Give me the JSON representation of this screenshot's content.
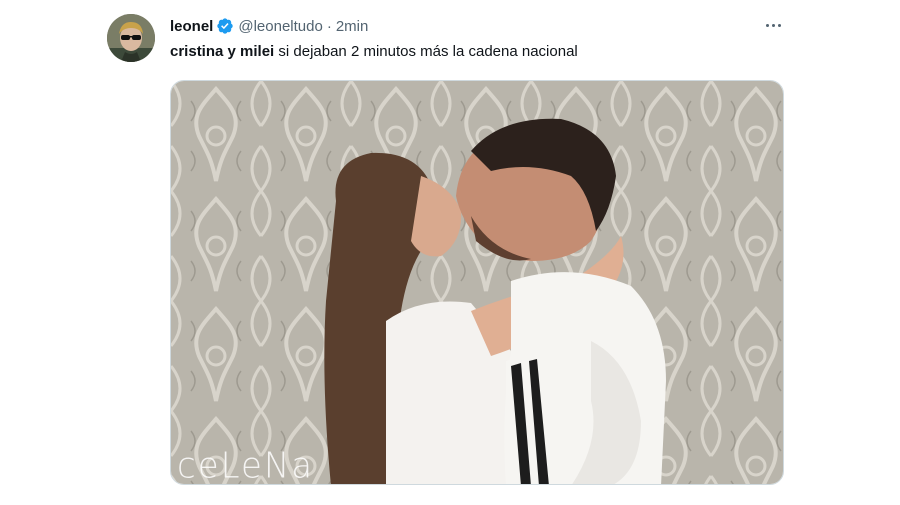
{
  "tweet": {
    "display_name": "leonel",
    "handle": "@leoneltudo",
    "separator": "·",
    "time": "2min",
    "text_bold": "cristina y milei",
    "text_rest": " si dejaban 2 minutos más la cadena nacional",
    "verified_color": "#1d9bf0",
    "media": {
      "watermark": "ceLeNa"
    }
  },
  "icons": {
    "verified": "verified-badge-icon",
    "more": "more-options-icon"
  }
}
